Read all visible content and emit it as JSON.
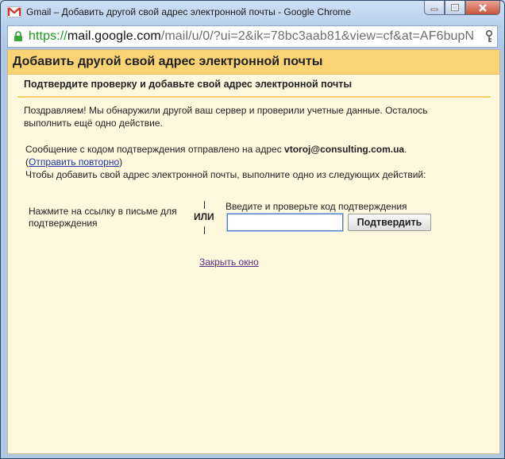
{
  "window": {
    "title": "Gmail – Добавить другой свой адрес электронной почты - Google Chrome",
    "app_icon": "gmail-icon"
  },
  "address_bar": {
    "scheme": "https://",
    "host": "mail.google.com",
    "path": "/mail/u/0/?ui=2&ik=78bc3aab81&view=cf&at=AF6bupN"
  },
  "dialog": {
    "title": "Добавить другой свой адрес электронной почты",
    "subtitle": "Подтвердите проверку и добавьте свой адрес электронной почты",
    "congrats_text": "Поздравляем! Мы обнаружили другой ваш сервер и проверили учетные данные. Осталось выполнить ещё одно действие.",
    "sent_text_prefix": "Сообщение с кодом подтверждения отправлено на адрес ",
    "email": "vtoroj@consulting.com.ua",
    "sent_text_suffix": ".",
    "paren_open": "(",
    "resend_link": "Отправить повторно",
    "paren_close": ")",
    "instruction": "Чтобы добавить свой адрес электронной почты, выполните одно из следующих действий:",
    "option_click_link": "Нажмите на ссылку в письме для подтверждения",
    "or_label": "ИЛИ",
    "option_code_label": "Введите и проверьте код подтверждения",
    "code_input_value": "",
    "confirm_button": "Подтвердить",
    "close_link": "Закрыть окно"
  },
  "colors": {
    "header_bg": "#f9d374",
    "content_bg": "#fef8df",
    "link": "#1c37a8",
    "visited_link": "#5a2d8a"
  }
}
